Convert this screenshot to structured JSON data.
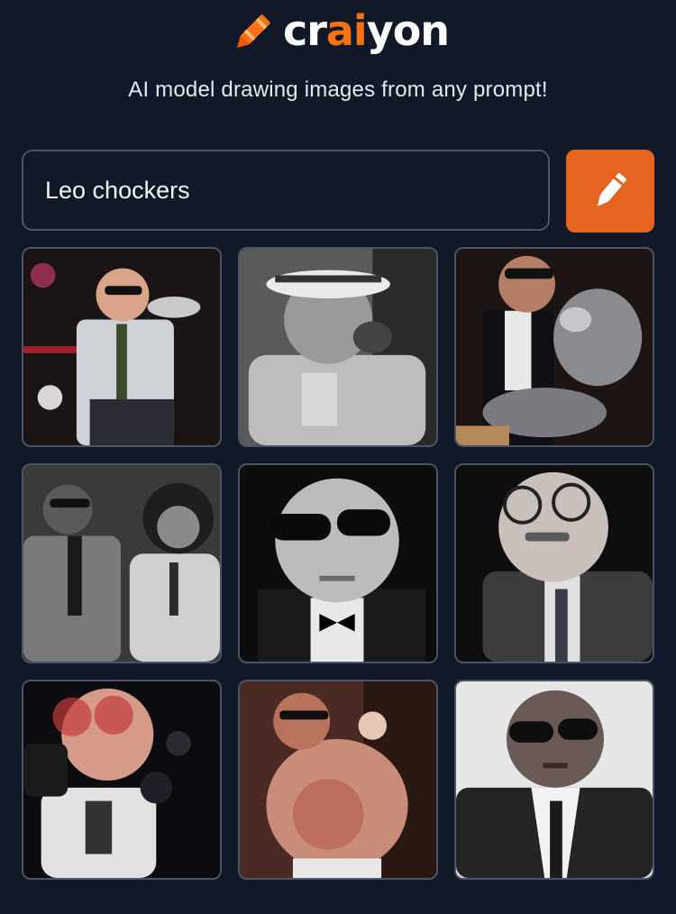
{
  "header": {
    "logo_text_prefix": "cr",
    "logo_text_accent": "ai",
    "logo_text_suffix": "yon",
    "tagline": "AI model drawing images from any prompt!"
  },
  "search": {
    "value": "Leo chockers",
    "button_icon": "pencil-icon"
  },
  "colors": {
    "background": "#111827",
    "accent": "#e56420",
    "border": "#4b5563"
  },
  "results": [
    {
      "scene": "man-sunglasses-striped-shirt-stage"
    },
    {
      "scene": "man-hat-sunglasses-bw-microphone"
    },
    {
      "scene": "man-sunglasses-metal-object"
    },
    {
      "scene": "two-men-suits-bw"
    },
    {
      "scene": "bald-man-sunglasses-bowtie-bw"
    },
    {
      "scene": "man-glasses-mustache-suit"
    },
    {
      "scene": "man-red-glasses-microphone"
    },
    {
      "scene": "shirtless-man-sunglasses-stage"
    },
    {
      "scene": "man-sunglasses-suit-portrait"
    }
  ]
}
